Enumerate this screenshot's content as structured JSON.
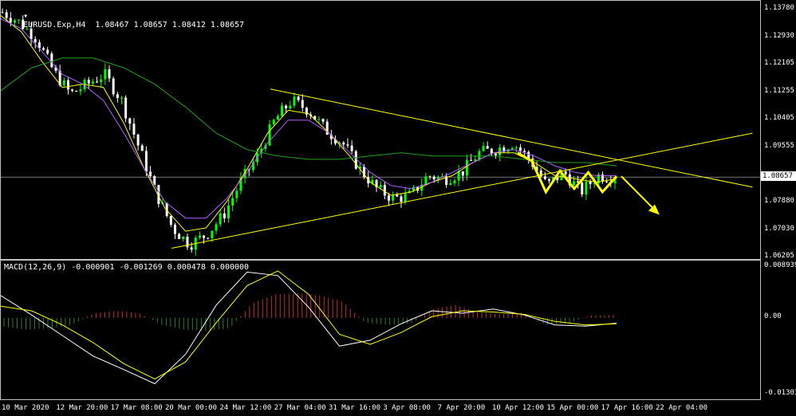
{
  "header": {
    "title": "EURUSD.Exp,H4  1.08467 1.08657 1.08412 1.08657"
  },
  "macd": {
    "title": "MACD(12,26,9) -0.000901 -0.001269 0.000478 0.000000"
  },
  "colors": {
    "bull": "#00ff00",
    "bear": "#ffffff",
    "ma_fast": "#ffff00",
    "ma_mid": "#b060ff",
    "ma_slow": "#20a020",
    "trend": "#ffff00",
    "hist_pos": "#c03030",
    "hist_neg": "#2e7d2e",
    "macd_line": "#ffffff",
    "signal_line": "#ffff00",
    "current_price": "#c0c0c0"
  },
  "price_axis": {
    "labels": [
      "1.13780",
      "1.12930",
      "1.12105",
      "1.11255",
      "1.10405",
      "1.09555",
      "1.08657",
      "1.07880",
      "1.07030",
      "1.06205"
    ],
    "current": "1.08657"
  },
  "macd_axis": {
    "labels": [
      "0.008939",
      "0.00",
      "-0.013037"
    ]
  },
  "time_axis": {
    "labels": [
      "10 Mar 2020",
      "12 Mar 20:00",
      "17 Mar 08:00",
      "20 Mar 00:00",
      "24 Mar 12:00",
      "27 Mar 04:00",
      "31 Mar 16:00",
      "3 Apr 08:00",
      "7 Apr 20:00",
      "10 Apr 12:00",
      "15 Apr 00:00",
      "17 Apr 16:00",
      "22 Apr 04:00"
    ]
  },
  "chart_data": [
    {
      "type": "candlestick",
      "title": "EURUSD.Exp,H4",
      "ylim": [
        1.0615,
        1.1405
      ],
      "x": [
        "10 Mar 2020",
        "12 Mar 20:00",
        "17 Mar 08:00",
        "20 Mar 00:00",
        "24 Mar 12:00",
        "27 Mar 04:00",
        "31 Mar 16:00",
        "3 Apr 08:00",
        "7 Apr 20:00",
        "10 Apr 12:00",
        "15 Apr 00:00",
        "17 Apr 16:00",
        "22 Apr 04:00"
      ],
      "close_path": [
        1.137,
        1.134,
        1.129,
        1.119,
        1.112,
        1.115,
        1.118,
        1.11,
        1.096,
        1.082,
        1.071,
        1.066,
        1.069,
        1.075,
        1.085,
        1.093,
        1.104,
        1.11,
        1.107,
        1.101,
        1.097,
        1.089,
        1.083,
        1.08,
        1.081,
        1.087,
        1.086,
        1.088,
        1.094,
        1.095,
        1.097,
        1.092,
        1.084,
        1.088,
        1.082,
        1.087,
        1.0866
      ],
      "series": [
        {
          "name": "MA fast",
          "values": [
            1.136,
            1.131,
            1.122,
            1.114,
            1.115,
            1.114,
            1.103,
            1.089,
            1.077,
            1.07,
            1.071,
            1.079,
            1.089,
            1.1,
            1.107,
            1.106,
            1.1,
            1.093,
            1.085,
            1.081,
            1.082,
            1.085,
            1.087,
            1.091,
            1.094,
            1.094,
            1.091,
            1.087,
            1.086,
            1.085,
            1.086
          ]
        },
        {
          "name": "MA mid",
          "values": [
            1.135,
            1.132,
            1.125,
            1.118,
            1.115,
            1.11,
            1.1,
            1.089,
            1.079,
            1.074,
            1.074,
            1.08,
            1.088,
            1.097,
            1.104,
            1.104,
            1.1,
            1.094,
            1.088,
            1.084,
            1.083,
            1.085,
            1.088,
            1.091,
            1.094,
            1.095,
            1.093,
            1.09,
            1.088,
            1.087,
            1.087
          ]
        },
        {
          "name": "MA slow",
          "values": [
            1.113,
            1.12,
            1.123,
            1.123,
            1.12,
            1.115,
            1.108,
            1.1,
            1.095,
            1.093,
            1.092,
            1.092,
            1.093,
            1.094,
            1.093,
            1.093,
            1.093,
            1.092,
            1.091,
            1.091,
            1.09
          ]
        }
      ],
      "annotations": {
        "upper_trendline": [
          [
            0.355,
            1.1135
          ],
          [
            0.99,
            1.0835
          ]
        ],
        "lower_trendline": [
          [
            0.225,
            1.0648
          ],
          [
            0.99,
            1.1
          ]
        ],
        "projection_zigzag": [
          1.094,
          1.0915,
          1.082,
          1.0885,
          1.083,
          1.088,
          1.082,
          1.0868
        ],
        "projection_arrow": [
          1.0868,
          1.076
        ]
      }
    },
    {
      "type": "histogram+line",
      "title": "MACD(12,26,9)",
      "ylim": [
        -0.013037,
        0.008939
      ],
      "histogram": [
        -0.0015,
        -0.002,
        -0.0018,
        -0.0012,
        0.0008,
        0.0012,
        0.0008,
        -0.0012,
        -0.002,
        -0.0022,
        -0.0018,
        0.0025,
        0.004,
        0.0042,
        0.0038,
        0.0028,
        -0.0008,
        -0.0012,
        -0.001,
        0.0015,
        0.0022,
        0.001,
        0.0006,
        0.0009,
        -0.0012,
        -0.0009,
        0.0004,
        0.0005
      ],
      "series": [
        {
          "name": "MACD",
          "values": [
            0.0038,
            0.0005,
            -0.003,
            -0.0065,
            -0.0088,
            -0.0112,
            -0.0062,
            0.0022,
            0.0078,
            0.0072,
            0.0018,
            -0.0048,
            -0.0038,
            -0.001,
            0.0012,
            0.0008,
            0.0015,
            0.0005,
            -0.0012,
            -0.0014,
            -0.0009
          ]
        },
        {
          "name": "Signal",
          "values": [
            0.002,
            0.0012,
            -0.0012,
            -0.0042,
            -0.0078,
            -0.0104,
            -0.0075,
            -0.0008,
            0.0055,
            0.008,
            0.004,
            -0.0028,
            -0.0045,
            -0.0025,
            0.0002,
            0.0012,
            0.001,
            0.0006,
            -0.0006,
            -0.0012,
            -0.001
          ]
        }
      ]
    }
  ]
}
